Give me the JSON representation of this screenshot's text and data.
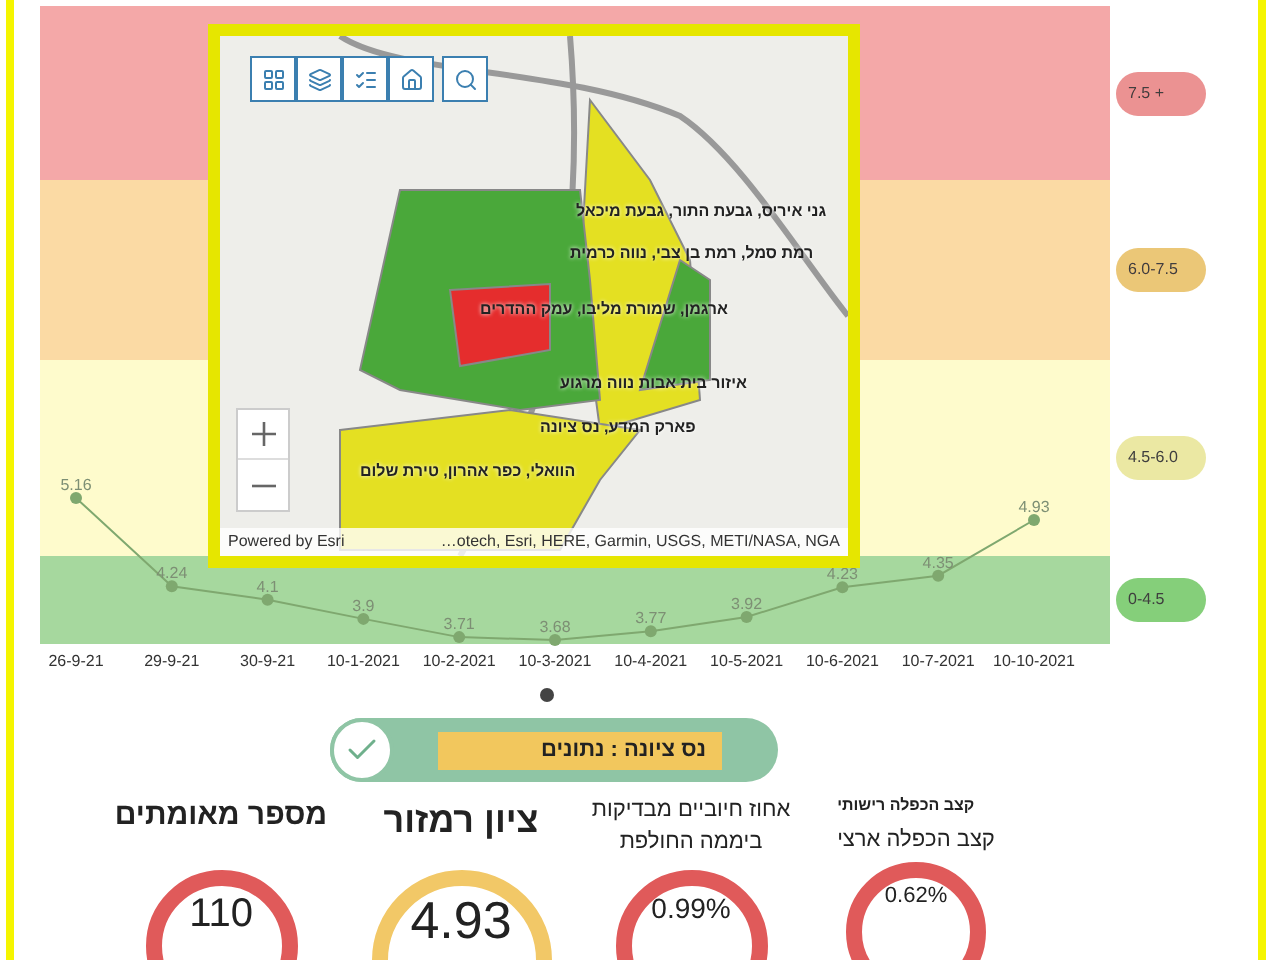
{
  "chart": {
    "chart_data": {
      "type": "line",
      "categories": [
        "26-9-21",
        "29-9-21",
        "30-9-21",
        "10-1-2021",
        "10-2-2021",
        "10-3-2021",
        "10-4-2021",
        "10-5-2021",
        "10-6-2021",
        "10-7-2021",
        "10-10-2021"
      ],
      "series": [
        {
          "color": "#7fa86f",
          "marker": true,
          "values": [
            5.16,
            4.24,
            4.1,
            3.9,
            3.71,
            3.68,
            3.77,
            3.92,
            4.23,
            4.35,
            4.93
          ]
        }
      ],
      "data_labels": true
    },
    "legend": [
      {
        "label": "7.5 +",
        "color": "#f4a8a8"
      },
      {
        "label": "6.0-7.5",
        "color": "#fbdaa4"
      },
      {
        "label": "4.5-6.0",
        "color": "#fefbcc"
      },
      {
        "label": "0-4.5",
        "color": "#a6d89e"
      }
    ]
  },
  "map": {
    "labels": [
      "גני איריס, גבעת התור, גבעת מיכאל",
      "רמת סמל, רמת בן צבי, נווה כרמית",
      "ארגמן, שמורת מליבו, עמק ההדרים",
      "איזור בית אבות נווה מרגוע",
      "פארק המדע, נס ציונה",
      "הוואלי, כפר אהרון, טירת שלום"
    ],
    "attribution_left": "Powered by Esri",
    "attribution_right": "…otech, Esri, HERE, Garmin, USGS, METI/NASA, NGA"
  },
  "status": {
    "label": "נס ציונה : נתונים",
    "checked": true
  },
  "gauges": {
    "doubling_rate": {
      "kind": "doubling",
      "title": [
        "קצב הכפלה רישותי",
        "קצב הכפלה ארצי"
      ],
      "value": "0.62%",
      "color": "#e05a5a"
    },
    "positive_rate": {
      "kind": "percent",
      "title": [
        "אחוז חיוביים מבדיקות",
        "ביממה החולפת"
      ],
      "value": "0.99%",
      "color": "#e05a5a"
    },
    "traffic_light_score": {
      "kind": "score",
      "title": [
        "ציון רמזור"
      ],
      "value": "4.93",
      "color": "#f2c867"
    },
    "confirmed_cases": {
      "kind": "count",
      "title": [
        "מספר מאומתים"
      ],
      "value": "110",
      "color": "#e05a5a"
    }
  }
}
